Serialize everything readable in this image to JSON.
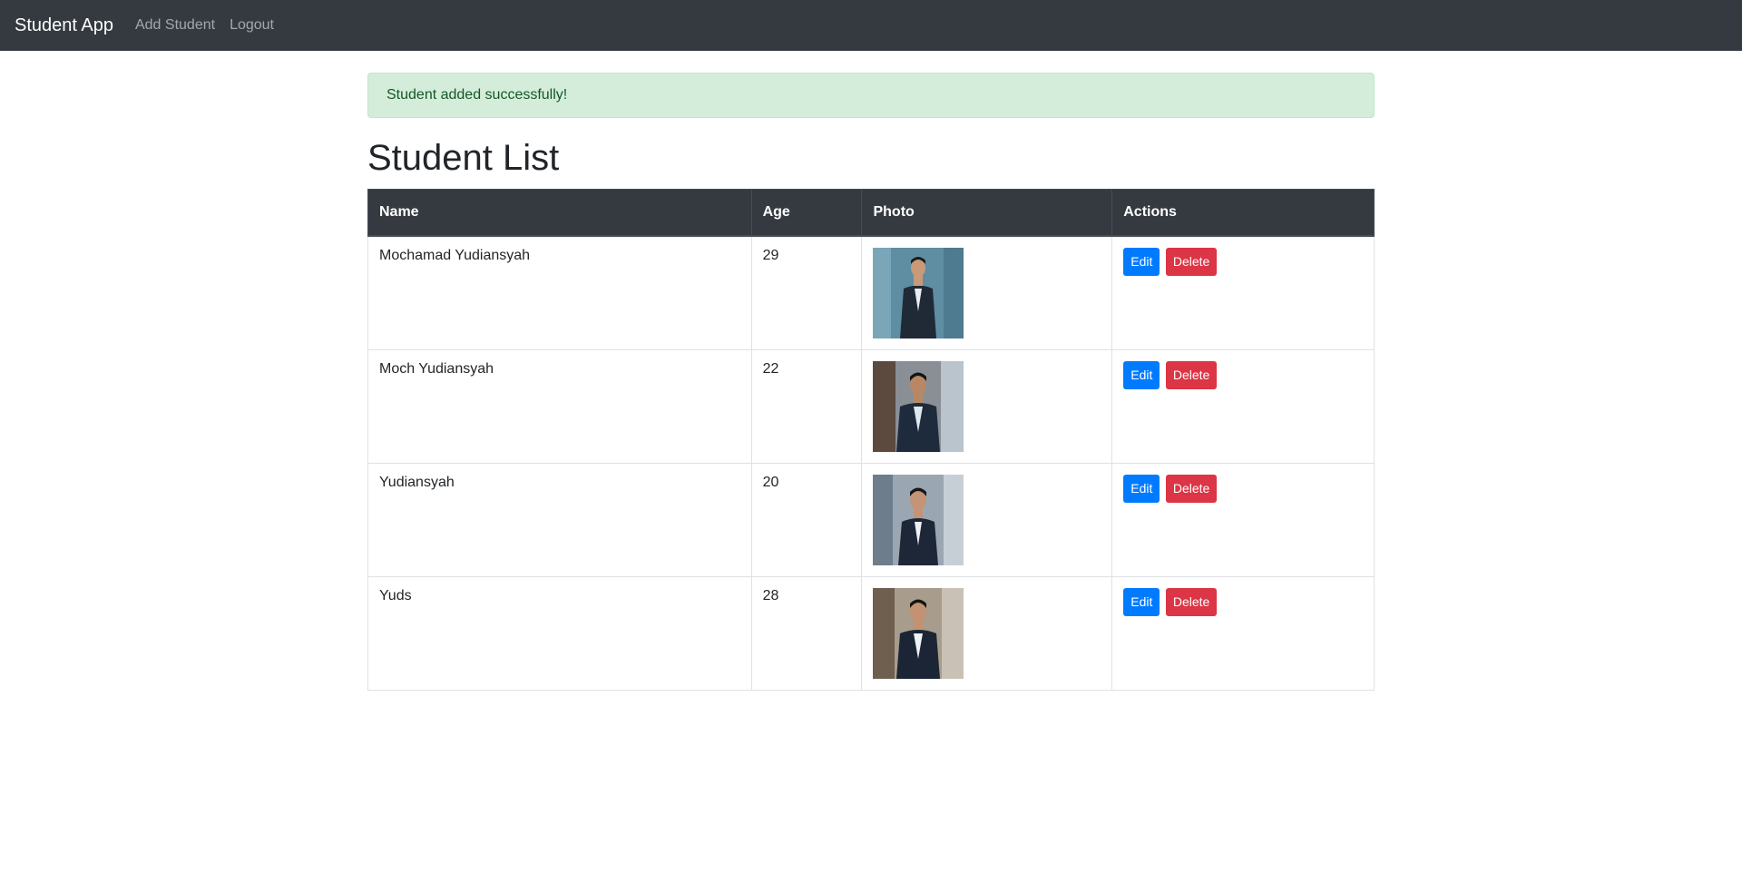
{
  "navbar": {
    "brand": "Student App",
    "links": [
      "Add Student",
      "Logout"
    ]
  },
  "alert": {
    "message": "Student added successfully!"
  },
  "page": {
    "title": "Student List"
  },
  "table": {
    "headers": [
      "Name",
      "Age",
      "Photo",
      "Actions"
    ],
    "rows": [
      {
        "name": "Mochamad Yudiansyah",
        "age": "29",
        "photo": "portrait of man in dark suit, glass building background"
      },
      {
        "name": "Moch Yudiansyah",
        "age": "22",
        "photo": "portrait of man in dark suit, city street background"
      },
      {
        "name": "Yudiansyah",
        "age": "20",
        "photo": "portrait of man in dark suit, street background"
      },
      {
        "name": "Yuds",
        "age": "28",
        "photo": "portrait of man in dark suit, building background"
      }
    ],
    "edit_label": "Edit",
    "delete_label": "Delete"
  },
  "colors": {
    "navbar_bg": "#343a40",
    "alert_bg": "#d4edda",
    "alert_text": "#155724",
    "edit_btn": "#007bff",
    "delete_btn": "#dc3545"
  }
}
